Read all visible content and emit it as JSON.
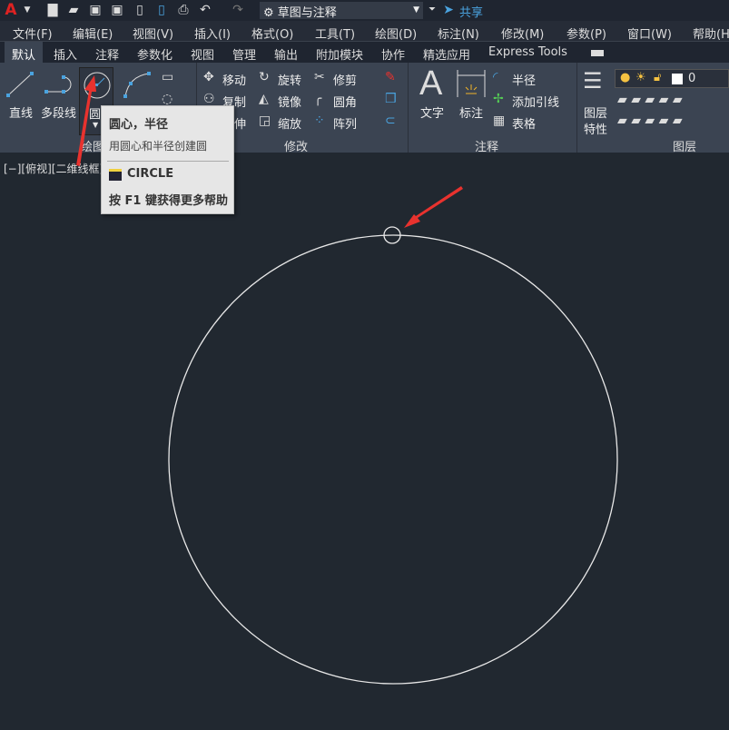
{
  "quick_access": {
    "workspace": "草图与注释",
    "share": "共享"
  },
  "menu": [
    "文件(F)",
    "编辑(E)",
    "视图(V)",
    "插入(I)",
    "格式(O)",
    "工具(T)",
    "绘图(D)",
    "标注(N)",
    "修改(M)",
    "参数(P)",
    "窗口(W)",
    "帮助(H)"
  ],
  "tabs": [
    "默认",
    "插入",
    "注释",
    "参数化",
    "视图",
    "管理",
    "输出",
    "附加模块",
    "协作",
    "精选应用",
    "Express Tools"
  ],
  "draw": {
    "line": "直线",
    "polyline": "多段线",
    "circle": "圆",
    "arc": "圆弧",
    "panel": "绘图"
  },
  "modify": {
    "move": "移动",
    "rotate": "旋转",
    "trim": "修剪",
    "copy": "复制",
    "mirror": "镜像",
    "fillet": "圆角",
    "stretch": "拉伸",
    "scale": "缩放",
    "array": "阵列",
    "panel": "修改"
  },
  "annotation": {
    "text": "文字",
    "dimension": "标注",
    "radius": "半径",
    "leader": "添加引线",
    "table": "表格",
    "panel": "注释"
  },
  "layers": {
    "properties_1": "图层",
    "properties_2": "特性",
    "current_layer": "0",
    "panel": "图层"
  },
  "tooltip": {
    "title": "圆心，半径",
    "desc": "用圆心和半径创建圆",
    "command": "CIRCLE",
    "help": "按 F1 键获得更多帮助"
  },
  "viewport": {
    "label": "[−][俯视][二维线框]"
  },
  "colors": {
    "accent": "#4aa3df",
    "arrow": "#e8322e",
    "canvas": "#212830"
  }
}
